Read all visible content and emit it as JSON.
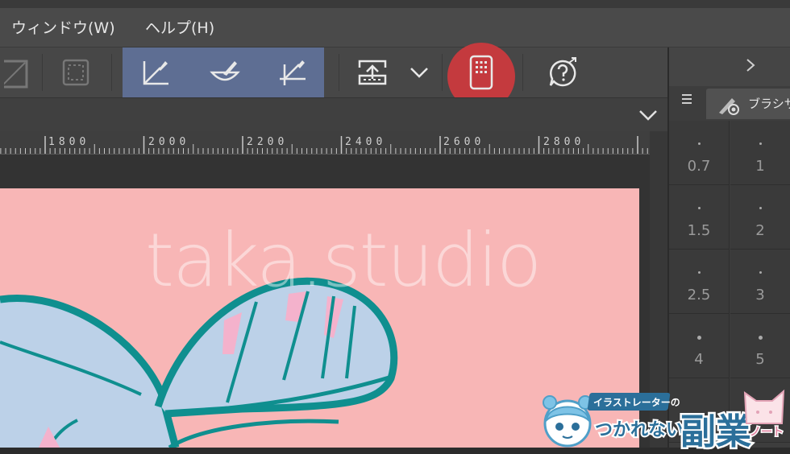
{
  "menu": {
    "window_label": "ウィンドウ(W)",
    "help_label": "ヘルプ(H)"
  },
  "ruler": {
    "labels": [
      "1800",
      "2000",
      "2200",
      "2400",
      "2600",
      "2800"
    ]
  },
  "right_panel": {
    "tab_label": "ブラシサ",
    "brush_sizes": [
      "0.7",
      "1",
      "1.5",
      "2",
      "2.5",
      "3",
      "4",
      "5"
    ]
  },
  "canvas": {
    "watermark": "taka.studio",
    "background_color": "#f8b6b6"
  },
  "logo": {
    "line1": "イラストレーターの",
    "line2": "つかれない",
    "line3": "副業",
    "line4": "ノート"
  },
  "colors": {
    "highlight_group": "#5e6e93",
    "highlight_circle": "#c43a3e",
    "line_art": "#0f8f8f",
    "fill_blue": "#bcd1e8",
    "fill_pink": "#f4b2cc"
  }
}
